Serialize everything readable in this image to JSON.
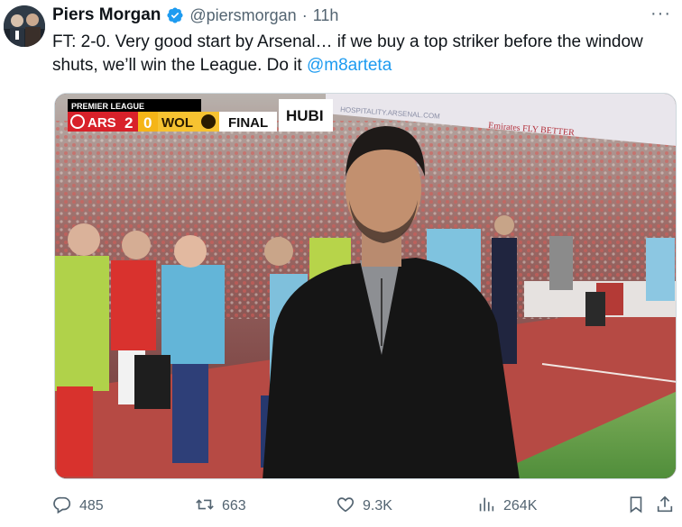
{
  "author": {
    "name": "Piers Morgan",
    "handle": "@piersmorgan",
    "separator": "·",
    "time": "11h",
    "verified_color": "#1d9bf0"
  },
  "tweet": {
    "text_before": "FT: 2-0. Very good start by Arsenal… if we buy a top striker before the window shuts, we’ll win the League. Do it ",
    "mention": "@m8arteta"
  },
  "media": {
    "league": "PREMIER LEAGUE",
    "home": "ARS",
    "home_score": "2",
    "away_score": "0",
    "away": "WOL",
    "status": "FINAL",
    "extra": "HUBI",
    "banner_text": "HOSPITALITY.ARSENAL.COM",
    "sponsor": "Emirates FLY BETTER"
  },
  "actions": {
    "replies": "485",
    "retweets": "663",
    "likes": "9.3K",
    "views": "264K"
  },
  "more_label": "···"
}
